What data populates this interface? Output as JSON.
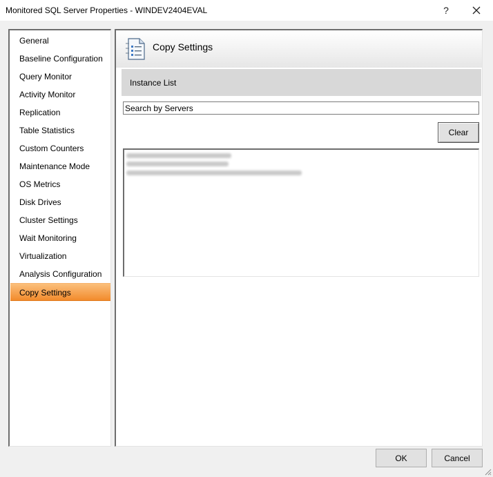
{
  "window": {
    "title": "Monitored SQL Server Properties - WINDEV2404EVAL",
    "help_label": "?",
    "close_label": "✕"
  },
  "nav": {
    "items": [
      {
        "label": "General"
      },
      {
        "label": "Baseline Configuration"
      },
      {
        "label": "Query Monitor"
      },
      {
        "label": "Activity Monitor"
      },
      {
        "label": "Replication"
      },
      {
        "label": "Table Statistics"
      },
      {
        "label": "Custom Counters"
      },
      {
        "label": "Maintenance Mode"
      },
      {
        "label": "OS Metrics"
      },
      {
        "label": "Disk Drives"
      },
      {
        "label": "Cluster Settings"
      },
      {
        "label": "Wait Monitoring"
      },
      {
        "label": "Virtualization"
      },
      {
        "label": "Analysis Configuration"
      },
      {
        "label": "Copy Settings"
      }
    ],
    "selected": "Copy Settings",
    "selected_color": "#f28b2c"
  },
  "panel": {
    "header_title": "Copy Settings",
    "header_icon": "settings-list-icon",
    "instance_list_label": "Instance List",
    "search": {
      "value": "",
      "placeholder": "Search by Servers"
    },
    "clear_label": "Clear",
    "server_list": {
      "note": "entries are blurred/redacted in the screenshot",
      "blurred_rows": 3
    }
  },
  "footer": {
    "ok_label": "OK",
    "cancel_label": "Cancel"
  }
}
